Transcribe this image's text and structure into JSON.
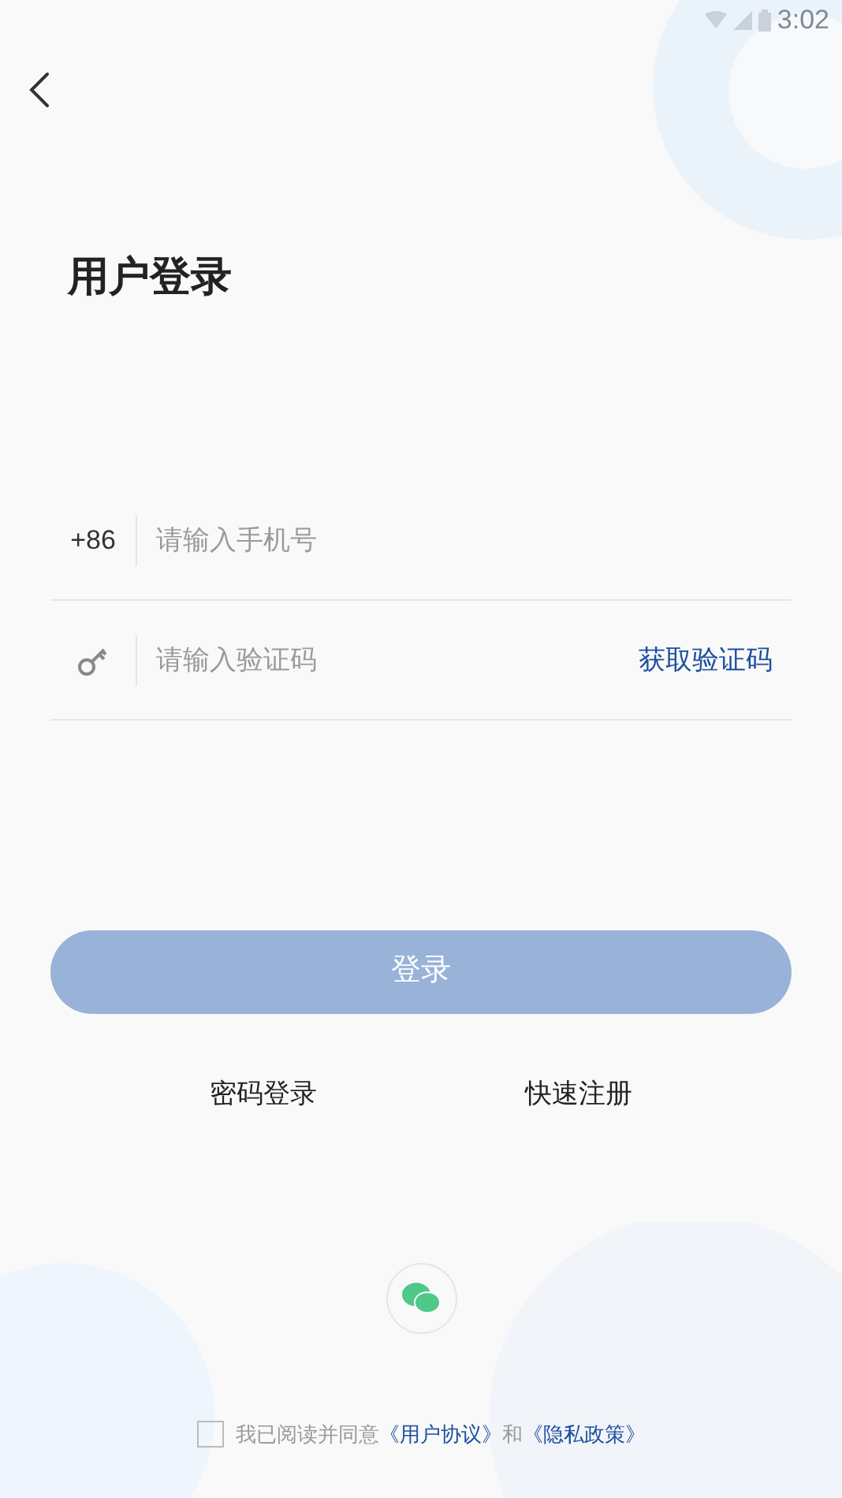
{
  "status_bar": {
    "time": "3:02"
  },
  "title": "用户登录",
  "phone": {
    "prefix": "+86",
    "placeholder": "请输入手机号"
  },
  "code": {
    "placeholder": "请输入验证码",
    "action": "获取验证码"
  },
  "login_button": {
    "label": "登录",
    "disabled": true
  },
  "links": [
    "密码登录",
    "快速注册"
  ],
  "agreement": {
    "checked": false,
    "text": "我已阅读并同意",
    "link_1": "《用户协议》",
    "conjunction": "和",
    "link_2": "《隐私政策》"
  }
}
